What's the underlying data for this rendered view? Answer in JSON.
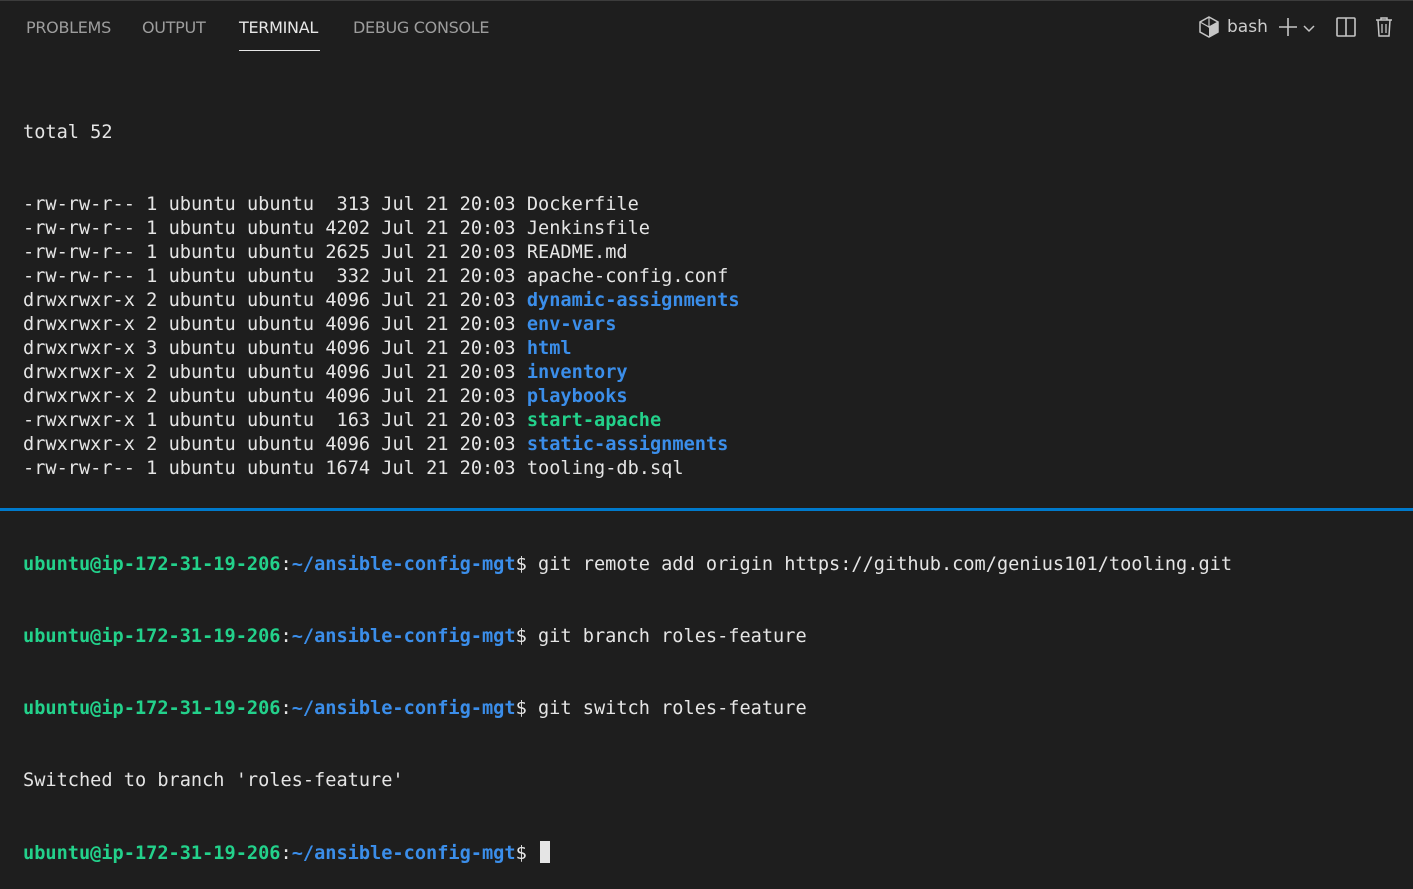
{
  "panel": {
    "tabs": [
      {
        "label": "PROBLEMS"
      },
      {
        "label": "OUTPUT"
      },
      {
        "label": "TERMINAL"
      },
      {
        "label": "DEBUG CONSOLE"
      }
    ],
    "active_tab": "TERMINAL",
    "shell_name": "bash",
    "icons": [
      "terminal-profile-icon",
      "plus-icon",
      "chevron-down-icon",
      "split-icon",
      "trash-icon"
    ]
  },
  "terminal": {
    "total_line": "total 52",
    "files": [
      {
        "perms": "-rw-rw-r--",
        "links": "1",
        "owner": "ubuntu",
        "group": "ubuntu",
        "size": " 313",
        "date": "Jul 21 20:03",
        "name": "Dockerfile",
        "kind": "file"
      },
      {
        "perms": "-rw-rw-r--",
        "links": "1",
        "owner": "ubuntu",
        "group": "ubuntu",
        "size": "4202",
        "date": "Jul 21 20:03",
        "name": "Jenkinsfile",
        "kind": "file"
      },
      {
        "perms": "-rw-rw-r--",
        "links": "1",
        "owner": "ubuntu",
        "group": "ubuntu",
        "size": "2625",
        "date": "Jul 21 20:03",
        "name": "README.md",
        "kind": "file"
      },
      {
        "perms": "-rw-rw-r--",
        "links": "1",
        "owner": "ubuntu",
        "group": "ubuntu",
        "size": " 332",
        "date": "Jul 21 20:03",
        "name": "apache-config.conf",
        "kind": "file"
      },
      {
        "perms": "drwxrwxr-x",
        "links": "2",
        "owner": "ubuntu",
        "group": "ubuntu",
        "size": "4096",
        "date": "Jul 21 20:03",
        "name": "dynamic-assignments",
        "kind": "dir"
      },
      {
        "perms": "drwxrwxr-x",
        "links": "2",
        "owner": "ubuntu",
        "group": "ubuntu",
        "size": "4096",
        "date": "Jul 21 20:03",
        "name": "env-vars",
        "kind": "dir"
      },
      {
        "perms": "drwxrwxr-x",
        "links": "3",
        "owner": "ubuntu",
        "group": "ubuntu",
        "size": "4096",
        "date": "Jul 21 20:03",
        "name": "html",
        "kind": "dir"
      },
      {
        "perms": "drwxrwxr-x",
        "links": "2",
        "owner": "ubuntu",
        "group": "ubuntu",
        "size": "4096",
        "date": "Jul 21 20:03",
        "name": "inventory",
        "kind": "dir"
      },
      {
        "perms": "drwxrwxr-x",
        "links": "2",
        "owner": "ubuntu",
        "group": "ubuntu",
        "size": "4096",
        "date": "Jul 21 20:03",
        "name": "playbooks",
        "kind": "dir"
      },
      {
        "perms": "-rwxrwxr-x",
        "links": "1",
        "owner": "ubuntu",
        "group": "ubuntu",
        "size": " 163",
        "date": "Jul 21 20:03",
        "name": "start-apache",
        "kind": "exec"
      },
      {
        "perms": "drwxrwxr-x",
        "links": "2",
        "owner": "ubuntu",
        "group": "ubuntu",
        "size": "4096",
        "date": "Jul 21 20:03",
        "name": "static-assignments",
        "kind": "dir"
      },
      {
        "perms": "-rw-rw-r--",
        "links": "1",
        "owner": "ubuntu",
        "group": "ubuntu",
        "size": "1674",
        "date": "Jul 21 20:03",
        "name": "tooling-db.sql",
        "kind": "file"
      }
    ],
    "prompt": {
      "user_host": "ubuntu@ip-172-31-19-206",
      "path": "~/ansible-config-mgt",
      "symbol": "$"
    },
    "commands": [
      " git remote add origin https://github.com/genius101/tooling.git",
      " git branch roles-feature",
      " git switch roles-feature"
    ],
    "output_after_switch": "Switched to branch 'roles-feature'"
  },
  "colors": {
    "background": "#1e1e1e",
    "directory": "#3b8eea",
    "executable": "#23d18b",
    "prompt_user": "#23d18b",
    "prompt_path": "#3b8eea",
    "accent": "#007acc"
  }
}
